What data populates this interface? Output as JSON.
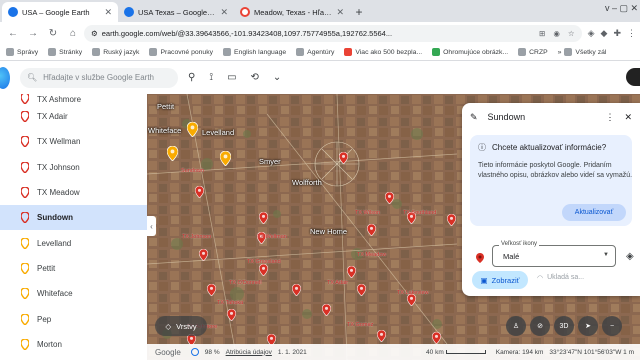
{
  "browser": {
    "tabs": [
      {
        "title": "USA – Google Earth",
        "favicon_color": "#1a73e8",
        "active": true
      },
      {
        "title": "USA Texas – Google Earth",
        "favicon_color": "#1a73e8",
        "active": false
      },
      {
        "title": "Meadow, Texas - Hľadať Goog",
        "favicon_color": "#ea4335",
        "active": false
      }
    ],
    "new_tab": "+",
    "window_controls": "v – ▢ ✕",
    "url": "earth.google.com/web/@33.39643566,-101.93423408,1097.75774955a,192762.5564...",
    "bookmarks": [
      "Správy",
      "Stránky",
      "Ruský jazyk",
      "Pracovné ponuky",
      "English language",
      "Agentúry",
      "Viac ako 500 bezpla...",
      "Ohromujúce obrázk...",
      "CRZP",
      "Všetky zál"
    ]
  },
  "earth": {
    "search_placeholder": "Hľadajte v službe Google Earth",
    "sidebar": [
      {
        "label": "TX Ashmore",
        "pin": "red"
      },
      {
        "label": "TX Adair",
        "pin": "red"
      },
      {
        "label": "TX Wellman",
        "pin": "red"
      },
      {
        "label": "TX Johnson",
        "pin": "red"
      },
      {
        "label": "TX Meadow",
        "pin": "red"
      },
      {
        "label": "Sundown",
        "pin": "red",
        "selected": true
      },
      {
        "label": "Levelland",
        "pin": "yellow"
      },
      {
        "label": "Pettit",
        "pin": "yellow"
      },
      {
        "label": "Whiteface",
        "pin": "yellow"
      },
      {
        "label": "Pep",
        "pin": "yellow"
      },
      {
        "label": "Morton",
        "pin": "yellow"
      }
    ],
    "map_labels": {
      "places": [
        "Pettit",
        "Whiteface",
        "Levelland",
        "Smyer",
        "Wolfforth",
        "New Home"
      ],
      "red": [
        "Sundown",
        "TX Wilson",
        "TX Southland",
        "TX Meadow",
        "TX Wellman",
        "TX Johnson",
        "TX Grassland",
        "TX O'Donnell",
        "TX Tahoka",
        "TX Adair",
        "TX Ashmore",
        "TX Gomez",
        "TX Lakeview"
      ]
    },
    "panel": {
      "title": "Sundown",
      "question": "Chcete aktualizovať informácie?",
      "body": "Tieto informácie poskytol Google. Pridaním vlastného opisu, obrázkov alebo videí sa vymažú.",
      "update_button": "Aktualizovať",
      "size_label": "Veľkosť ikony",
      "size_value": "Malé",
      "show_button": "Zobraziť",
      "saving_text": "Ukladá sa..."
    },
    "layers_label": "Vrstvy",
    "controls": [
      "3D"
    ],
    "status": {
      "brand": "Google",
      "percent": "98 %",
      "attribution": "Atribúcia údajov",
      "date": "1. 1. 2021",
      "scale": "40 km",
      "camera": "Kamera: 194 km",
      "coords": "33°23'47\"N 101°56'03\"W  1 m"
    }
  },
  "colors": {
    "accent": "#1a73e8",
    "pin_red": "#d93025",
    "pin_yellow": "#f9ab00",
    "selected": "#d2e3fc"
  }
}
